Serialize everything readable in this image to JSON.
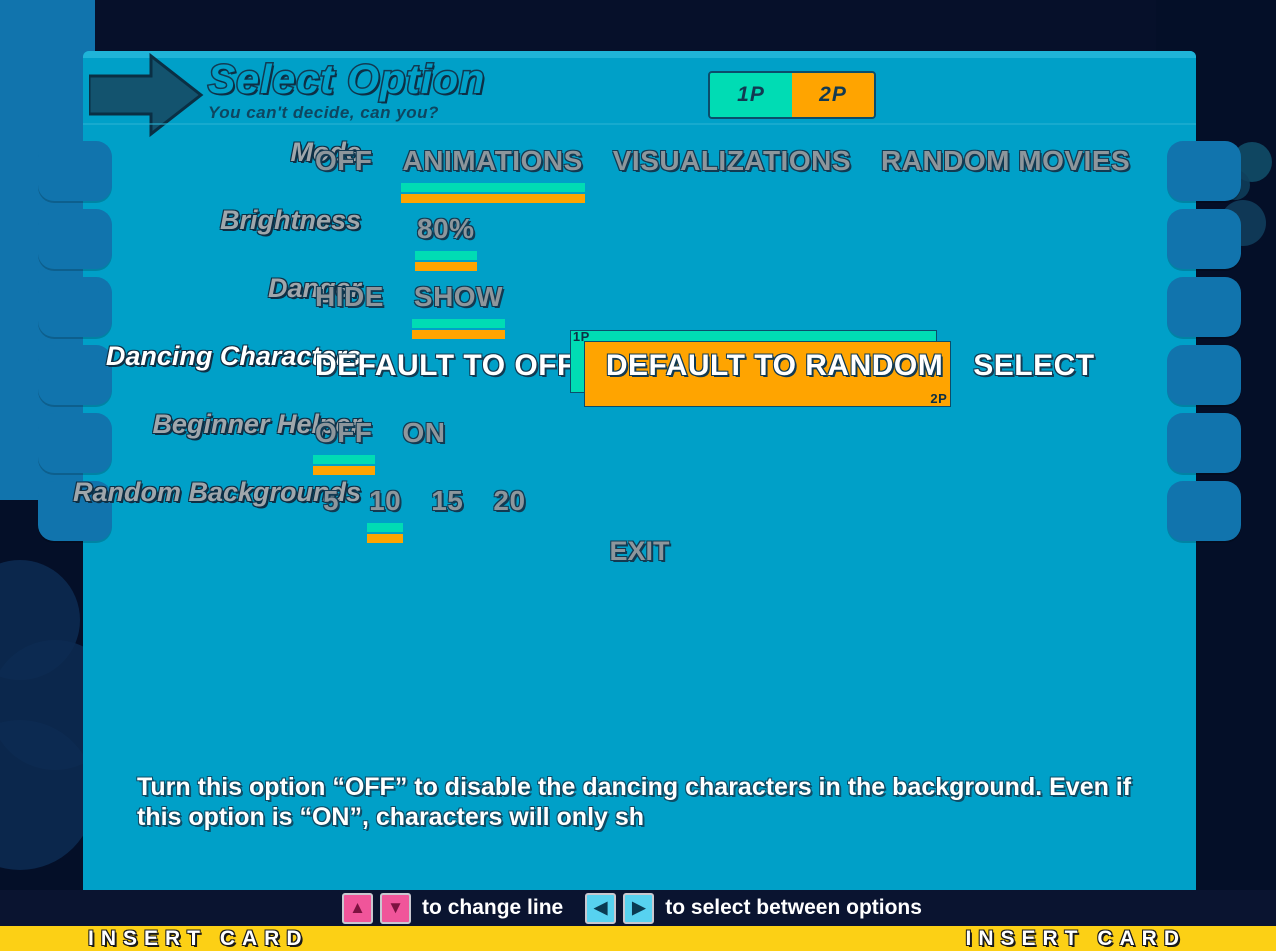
{
  "header": {
    "arrow_icon": "right-arrow-icon",
    "title": "Select Option",
    "subtitle": "You can't decide, can you?",
    "player_badge": {
      "p1": "1P",
      "p2": "2P"
    }
  },
  "colors": {
    "panel": "#00a0c8",
    "p1_teal": "#00dcb4",
    "p2_orange": "#ffa400",
    "label_gray": "#9fa6ab",
    "label_active": "#ffffff",
    "outline_dark": "#123a52",
    "footer_dark": "#0a1430",
    "insert_yellow": "#fcd015"
  },
  "rows": [
    {
      "label": "Mode",
      "active": false,
      "choices": [
        "OFF",
        "ANIMATIONS",
        "VISUALIZATIONS",
        "RANDOM MOVIES"
      ],
      "selected_index": 1
    },
    {
      "label": "Brightness",
      "active": false,
      "choices": [
        "80%"
      ],
      "selected_index": 0
    },
    {
      "label": "Danger",
      "active": false,
      "choices": [
        "HIDE",
        "SHOW"
      ],
      "selected_index": 1
    },
    {
      "label": "Dancing Characters",
      "active": true,
      "choices": [
        "DEFAULT TO OFF",
        "DEFAULT TO RANDOM",
        "SELECT"
      ],
      "selected_index": 1
    },
    {
      "label": "Beginner Helper",
      "active": false,
      "choices": [
        "OFF",
        "ON"
      ],
      "selected_index": 0
    },
    {
      "label": "Random Backgrounds",
      "active": false,
      "choices": [
        "5",
        "10",
        "15",
        "20"
      ],
      "selected_index": 1
    }
  ],
  "exit_label": "EXIT",
  "help_text": "Turn this option “OFF” to disable the dancing characters in the background. Even if this option is “ON”, characters will only sh",
  "footer": {
    "hints": [
      {
        "icons": [
          "arrow-up-icon",
          "arrow-down-icon"
        ],
        "style": "pink",
        "glyphs": [
          "▲",
          "▼"
        ],
        "text": "to change line"
      },
      {
        "icons": [
          "arrow-left-icon",
          "arrow-right-icon"
        ],
        "style": "cyan",
        "glyphs": [
          "◀",
          "▶"
        ],
        "text": "to select between options"
      }
    ],
    "insert_left": "INSERT CARD",
    "insert_right": "INSERT CARD"
  }
}
